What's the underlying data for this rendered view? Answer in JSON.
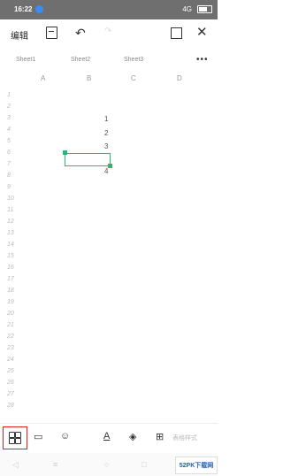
{
  "status_bar": {
    "time": "16:22",
    "right_text": "4G",
    "battery": "86"
  },
  "toolbar": {
    "doc_label": "编辑",
    "icons": [
      "save-icon",
      "undo-icon",
      "redo-icon",
      "fullscreen-icon",
      "close-icon"
    ]
  },
  "sheet_tabs": [
    "Sheet1",
    "Sheet2",
    "Sheet3"
  ],
  "more_label": "•••",
  "columns": [
    "A",
    "B",
    "C",
    "D"
  ],
  "row_numbers": [
    "1",
    "2",
    "3",
    "4",
    "5",
    "6",
    "7",
    "8",
    "9",
    "10",
    "11",
    "12",
    "13",
    "14",
    "15",
    "16",
    "17",
    "18",
    "19",
    "20",
    "21",
    "22",
    "23",
    "24",
    "25",
    "26",
    "27",
    "28"
  ],
  "cell_values": [
    "1",
    "2",
    "3",
    "4"
  ],
  "bottom_bar": {
    "label": "表格样式"
  },
  "watermark": "52PK下载网"
}
